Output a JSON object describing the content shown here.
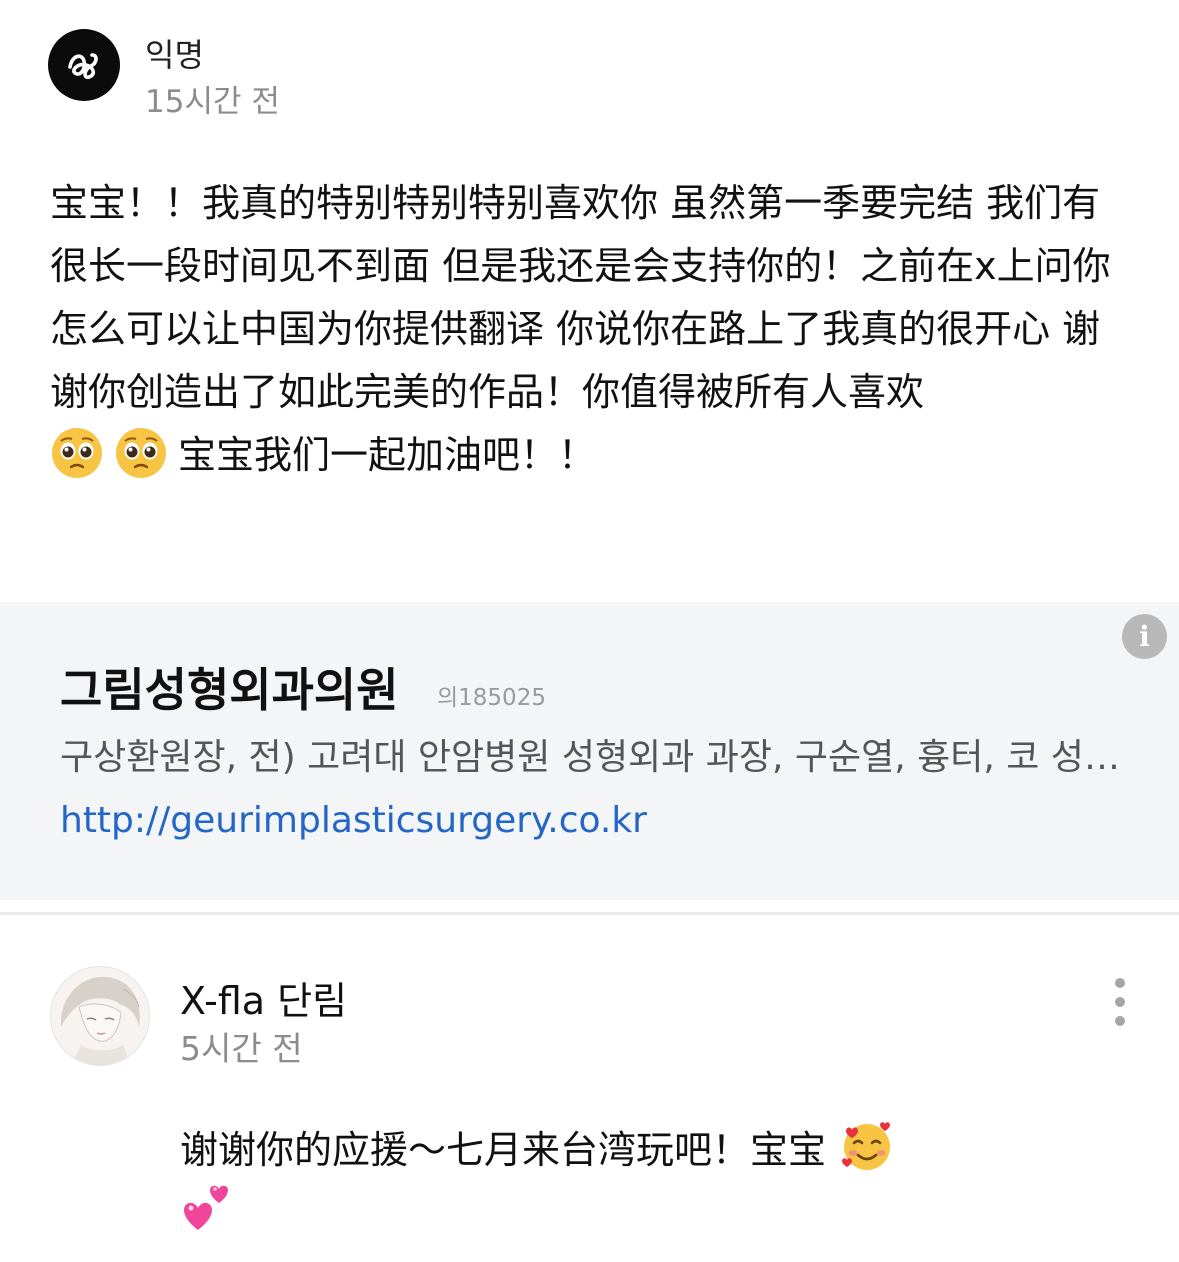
{
  "comment": {
    "author": "익명",
    "time": "15시간 전",
    "body_text": "宝宝！！我真的特别特别特别喜欢你 虽然第一季要完结 我们有很长一段时间见不到面 但是我还是会支持你的！之前在x上问你怎么可以让中国为你提供翻译 你说你在路上了我真的很开心 谢谢你创造出了如此完美的作品！你值得被所有人喜欢",
    "body_tail": "宝宝我们一起加油吧！！",
    "emoji": "pleading-face"
  },
  "ad": {
    "title": "그림성형외과의원",
    "code": "의185025",
    "description": "구상환원장, 전) 고려대 안암병원 성형외과 과장, 구순열, 흉터, 코 성형, 눈 성형",
    "url": "http://geurimplasticsurgery.co.kr"
  },
  "reply": {
    "author": "X-fla 단림",
    "time": "5시간 전",
    "body": "谢谢你的应援～七月来台湾玩吧！宝宝",
    "emoji_1": "smiling-face-with-hearts",
    "emoji_2": "two-hearts"
  },
  "colors": {
    "link": "#2266c8",
    "muted": "#8c8c8c",
    "ad_background": "#f4f5f7",
    "avatar_dark": "#0b0b0b"
  }
}
